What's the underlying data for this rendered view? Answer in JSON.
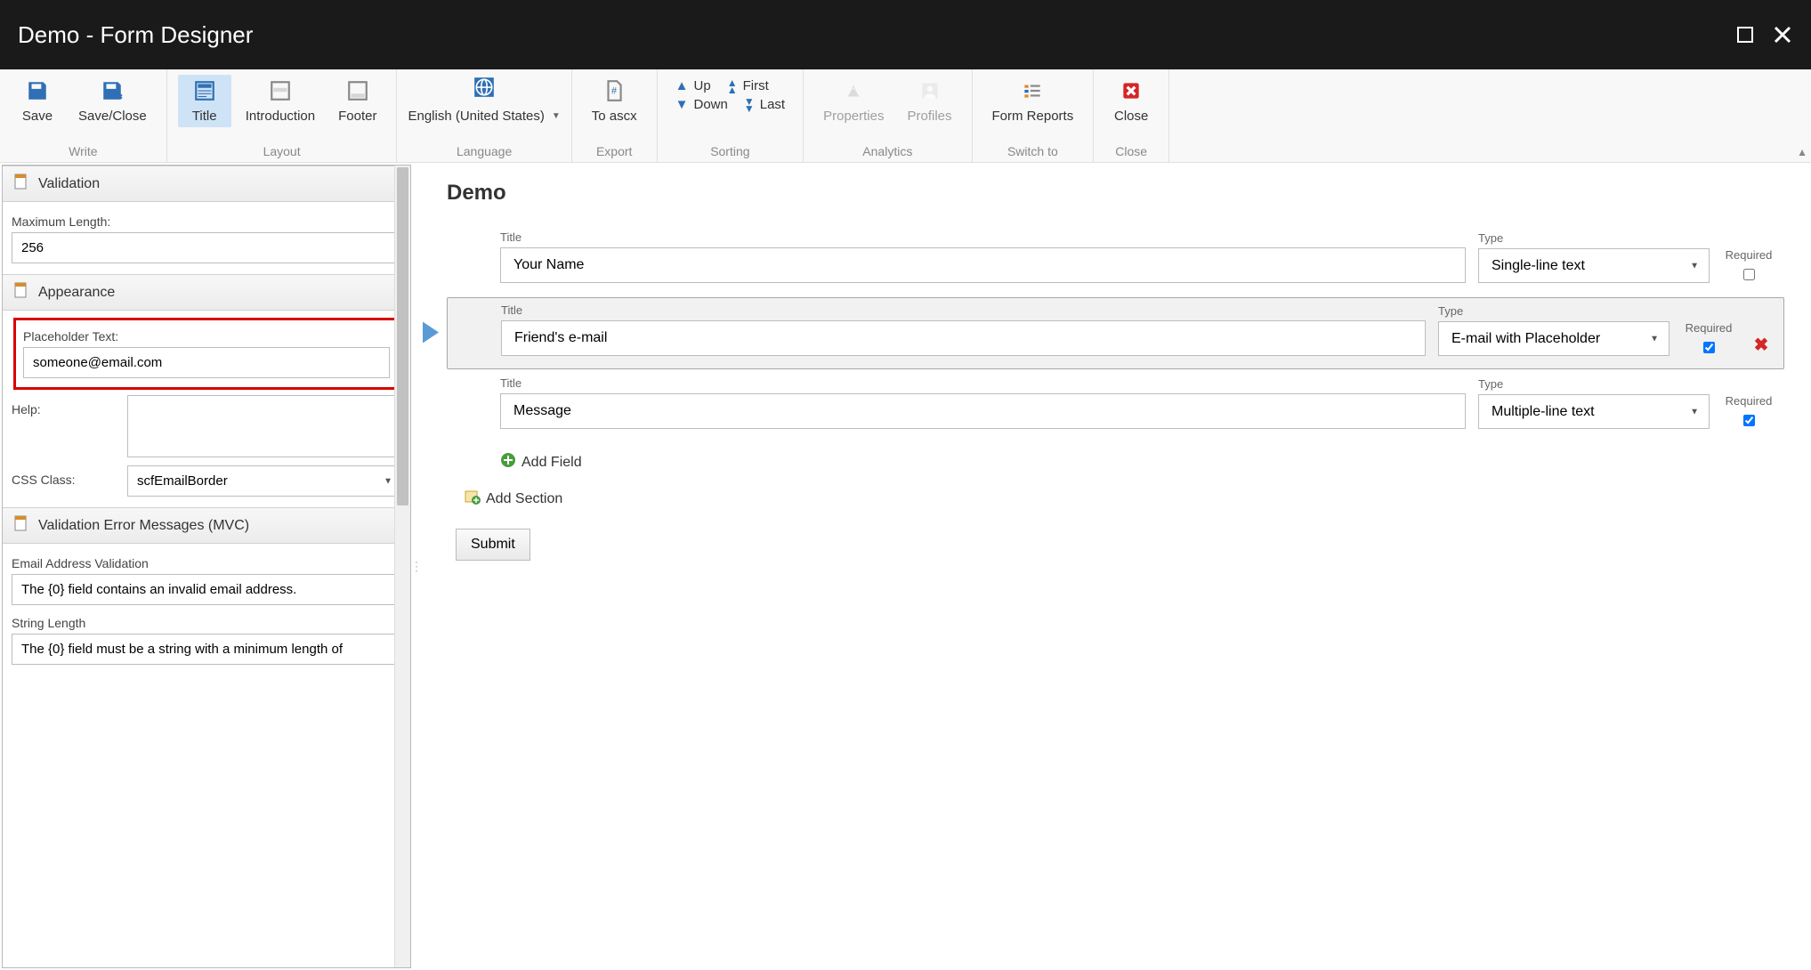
{
  "titlebar": {
    "title": "Demo - Form Designer"
  },
  "ribbon": {
    "write": {
      "caption": "Write",
      "save": "Save",
      "save_close": "Save/Close"
    },
    "layout": {
      "caption": "Layout",
      "title": "Title",
      "introduction": "Introduction",
      "footer": "Footer"
    },
    "language": {
      "caption": "Language",
      "value": "English (United States)"
    },
    "export": {
      "caption": "Export",
      "to_ascx": "To ascx"
    },
    "sorting": {
      "caption": "Sorting",
      "up": "Up",
      "down": "Down",
      "first": "First",
      "last": "Last"
    },
    "analytics": {
      "caption": "Analytics",
      "properties": "Properties",
      "profiles": "Profiles"
    },
    "switch": {
      "caption": "Switch to",
      "form_reports": "Form Reports"
    },
    "close": {
      "caption": "Close",
      "close": "Close"
    }
  },
  "side": {
    "validation": {
      "header": "Validation",
      "max_length_label": "Maximum Length:",
      "max_length_value": "256"
    },
    "appearance": {
      "header": "Appearance",
      "placeholder_label": "Placeholder Text:",
      "placeholder_value": "someone@email.com",
      "help_label": "Help:",
      "help_value": "",
      "css_label": "CSS Class:",
      "css_value": "scfEmailBorder"
    },
    "errors": {
      "header": "Validation Error Messages (MVC)",
      "email_label": "Email Address Validation",
      "email_value": "The {0} field contains an invalid email address.",
      "strlen_label": "String Length",
      "strlen_value": "The {0} field must be a string with a minimum length of"
    }
  },
  "canvas": {
    "title": "Demo",
    "labels": {
      "title": "Title",
      "type": "Type",
      "required": "Required"
    },
    "rows": [
      {
        "title": "Your Name",
        "type": "Single-line text",
        "required": false,
        "selected": false
      },
      {
        "title": "Friend's e-mail",
        "type": "E-mail with Placeholder",
        "required": true,
        "selected": true
      },
      {
        "title": "Message",
        "type": "Multiple-line text",
        "required": true,
        "selected": false
      }
    ],
    "add_field": "Add Field",
    "add_section": "Add Section",
    "submit": "Submit"
  }
}
